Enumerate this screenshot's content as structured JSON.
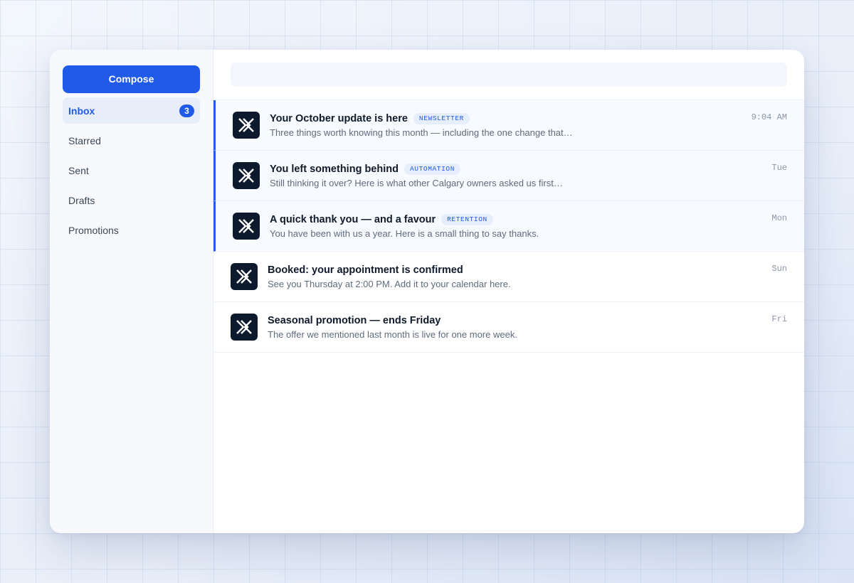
{
  "sidebar": {
    "compose_label": "Compose",
    "items": [
      {
        "label": "Inbox",
        "badge": "3"
      },
      {
        "label": "Starred"
      },
      {
        "label": "Sent"
      },
      {
        "label": "Drafts"
      },
      {
        "label": "Promotions"
      }
    ]
  },
  "search": {
    "placeholder": ""
  },
  "messages": [
    {
      "subject": "Your October update is here",
      "tag": "NEWSLETTER",
      "preview": "Three things worth knowing this month — including the one change that…",
      "time": "9:04 AM",
      "unread": true
    },
    {
      "subject": "You left something behind",
      "tag": "AUTOMATION",
      "preview": "Still thinking it over? Here is what other Calgary owners asked us first…",
      "time": "Tue",
      "unread": true
    },
    {
      "subject": "A quick thank you — and a favour",
      "tag": "RETENTION",
      "preview": "You have been with us a year. Here is a small thing to say thanks.",
      "time": "Mon",
      "unread": true
    },
    {
      "subject": "Booked: your appointment is confirmed",
      "preview": "See you Thursday at 2:00 PM. Add it to your calendar here.",
      "time": "Sun",
      "unread": false
    },
    {
      "subject": "Seasonal promotion — ends Friday",
      "preview": "The offer we mentioned last month is live for one more week.",
      "time": "Fri",
      "unread": false
    }
  ],
  "icons": {
    "sender_avatar": "brand-x-logo-icon"
  },
  "colors": {
    "accent": "#1f5ae8",
    "avatar_bg": "#0d1a2e",
    "unread_bg": "#f7faff"
  }
}
